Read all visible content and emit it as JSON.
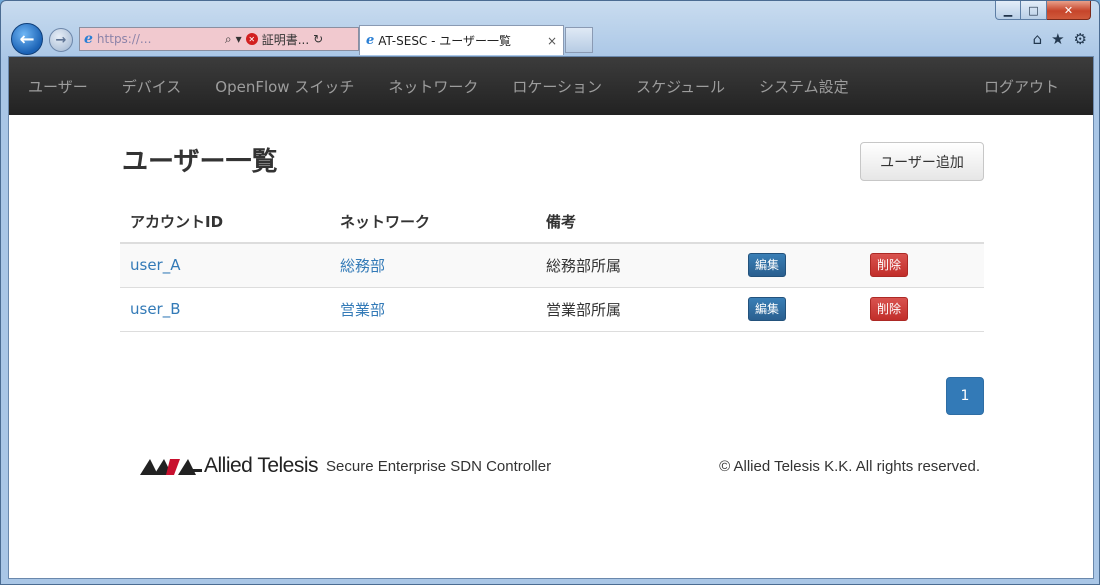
{
  "browser": {
    "url_text": "https://...",
    "cert_label": "証明書...",
    "tab_title": "AT-SESC - ユーザー一覧",
    "tab_close": "×",
    "minimize_glyph": "▁",
    "maximize_glyph": "□",
    "close_glyph": "✕",
    "back_glyph": "←",
    "forward_glyph": "→",
    "icons": [
      "home-icon",
      "favorites-star-icon",
      "tools-gear-icon"
    ]
  },
  "navbar": {
    "items": [
      {
        "label": "ユーザー"
      },
      {
        "label": "デバイス"
      },
      {
        "label": "OpenFlow スイッチ"
      },
      {
        "label": "ネットワーク"
      },
      {
        "label": "ロケーション"
      },
      {
        "label": "スケジュール"
      },
      {
        "label": "システム設定"
      }
    ],
    "logout": "ログアウト"
  },
  "page": {
    "title": "ユーザー一覧",
    "add_button": "ユーザー追加"
  },
  "table": {
    "headers": [
      "アカウントID",
      "ネットワーク",
      "備考",
      "",
      ""
    ],
    "rows": [
      {
        "account": "user_A",
        "network": "総務部",
        "note": "総務部所属",
        "edit": "編集",
        "delete": "削除"
      },
      {
        "account": "user_B",
        "network": "営業部",
        "note": "営業部所属",
        "edit": "編集",
        "delete": "削除"
      }
    ]
  },
  "pagination": {
    "current": "1"
  },
  "footer": {
    "logo_text": "Allied Telesis",
    "product": "Secure Enterprise SDN Controller",
    "copyright": "© Allied Telesis K.K. All rights reserved."
  },
  "colors": {
    "navbar": "#222222",
    "link": "#337ab7",
    "edit_button": "#2a5f8f",
    "delete_button": "#c12e2a",
    "pager": "#337ab7"
  }
}
